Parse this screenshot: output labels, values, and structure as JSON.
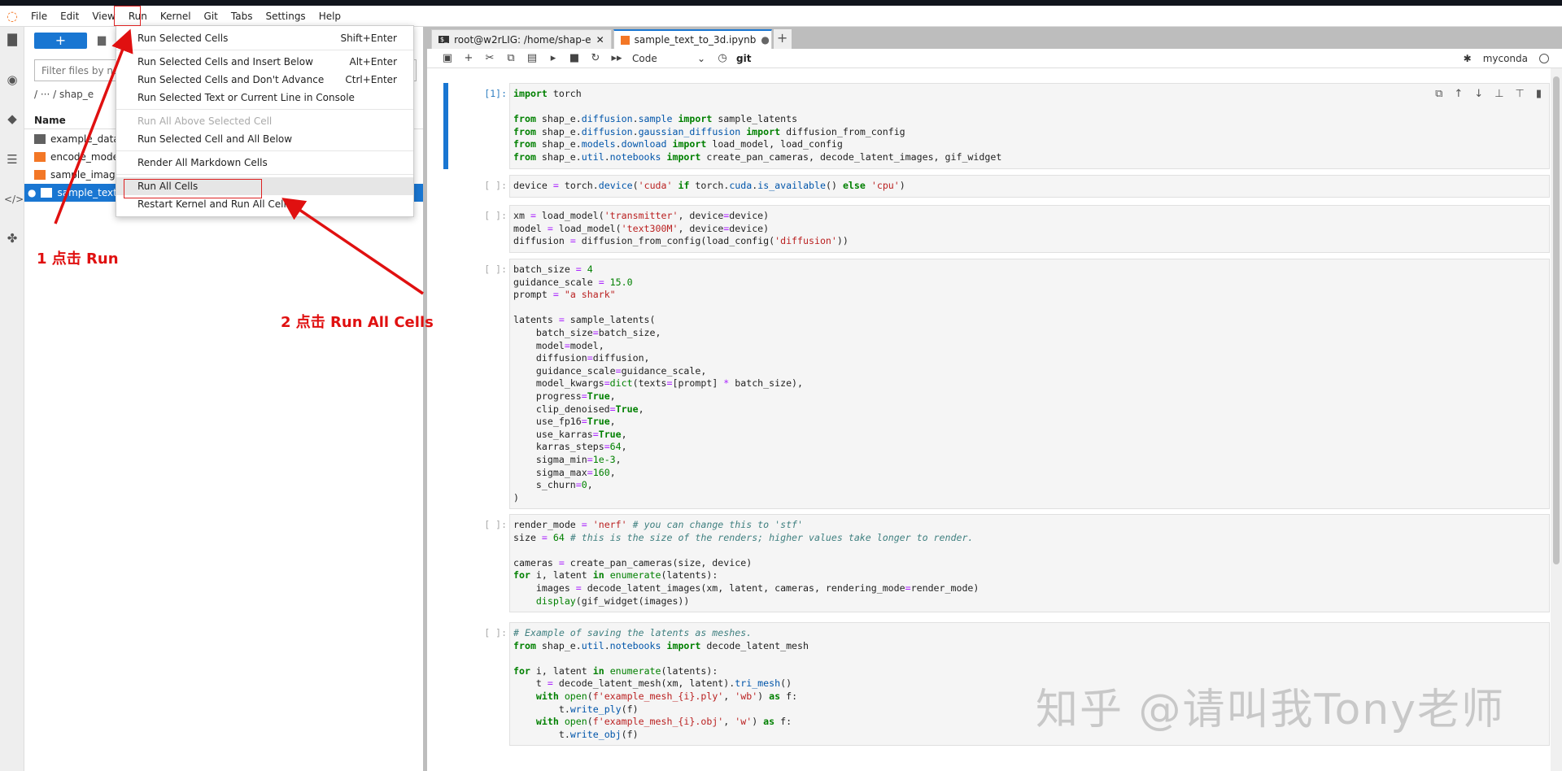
{
  "menubar": {
    "items": [
      "File",
      "Edit",
      "View",
      "Run",
      "Kernel",
      "Git",
      "Tabs",
      "Settings",
      "Help"
    ]
  },
  "sidebar_icons": [
    "folder-icon",
    "running-icon",
    "git-icon",
    "toc-icon",
    "property-inspector-icon",
    "extension-icon"
  ],
  "filebrowser": {
    "new_label": "+",
    "filter_placeholder": "Filter files by name",
    "breadcrumb": "/   ···   / shap_e",
    "name_header": "Name",
    "files": [
      {
        "name": "example_data",
        "type": "folder"
      },
      {
        "name": "encode_model",
        "type": "notebook"
      },
      {
        "name": "sample_image_",
        "type": "notebook"
      },
      {
        "name": "sample_text_to",
        "type": "notebook",
        "selected": true
      }
    ]
  },
  "run_menu": {
    "groups": [
      [
        {
          "label": "Run Selected Cells",
          "shortcut": "Shift+Enter"
        }
      ],
      [
        {
          "label": "Run Selected Cells and Insert Below",
          "shortcut": "Alt+Enter"
        },
        {
          "label": "Run Selected Cells and Don't Advance",
          "shortcut": "Ctrl+Enter"
        },
        {
          "label": "Run Selected Text or Current Line in Console",
          "shortcut": ""
        }
      ],
      [
        {
          "label": "Run All Above Selected Cell",
          "shortcut": "",
          "disabled": true
        },
        {
          "label": "Run Selected Cell and All Below",
          "shortcut": ""
        }
      ],
      [
        {
          "label": "Render All Markdown Cells",
          "shortcut": ""
        }
      ],
      [
        {
          "label": "Run All Cells",
          "shortcut": "",
          "highlighted": true
        },
        {
          "label": "Restart Kernel and Run All Cells...",
          "shortcut": ""
        }
      ]
    ]
  },
  "tabs": [
    {
      "label": "root@w2rLIG: /home/shap-e",
      "type": "terminal",
      "close": "✕"
    },
    {
      "label": "sample_text_to_3d.ipynb",
      "type": "notebook",
      "active": true,
      "close": "●"
    }
  ],
  "toolbar": {
    "cell_type": "Code",
    "git": "git",
    "kernel_name": "myconda"
  },
  "cells": [
    {
      "prompt": "[1]:",
      "active": true,
      "lines": [
        "import torch",
        "",
        "from shap_e.diffusion.sample import sample_latents",
        "from shap_e.diffusion.gaussian_diffusion import diffusion_from_config",
        "from shap_e.models.download import load_model, load_config",
        "from shap_e.util.notebooks import create_pan_cameras, decode_latent_images, gif_widget"
      ]
    },
    {
      "prompt": "[ ]:",
      "lines": [
        "device = torch.device('cuda' if torch.cuda.is_available() else 'cpu')"
      ]
    },
    {
      "prompt": "[ ]:",
      "lines": [
        "xm = load_model('transmitter', device=device)",
        "model = load_model('text300M', device=device)",
        "diffusion = diffusion_from_config(load_config('diffusion'))"
      ]
    },
    {
      "prompt": "[ ]:",
      "lines": [
        "batch_size = 4",
        "guidance_scale = 15.0",
        "prompt = \"a shark\"",
        "",
        "latents = sample_latents(",
        "    batch_size=batch_size,",
        "    model=model,",
        "    diffusion=diffusion,",
        "    guidance_scale=guidance_scale,",
        "    model_kwargs=dict(texts=[prompt] * batch_size),",
        "    progress=True,",
        "    clip_denoised=True,",
        "    use_fp16=True,",
        "    use_karras=True,",
        "    karras_steps=64,",
        "    sigma_min=1e-3,",
        "    sigma_max=160,",
        "    s_churn=0,",
        ")"
      ]
    },
    {
      "prompt": "[ ]:",
      "lines": [
        "render_mode = 'nerf' # you can change this to 'stf'",
        "size = 64 # this is the size of the renders; higher values take longer to render.",
        "",
        "cameras = create_pan_cameras(size, device)",
        "for i, latent in enumerate(latents):",
        "    images = decode_latent_images(xm, latent, cameras, rendering_mode=render_mode)",
        "    display(gif_widget(images))"
      ]
    },
    {
      "prompt": "[ ]:",
      "lines": [
        "# Example of saving the latents as meshes.",
        "from shap_e.util.notebooks import decode_latent_mesh",
        "",
        "for i, latent in enumerate(latents):",
        "    t = decode_latent_mesh(xm, latent).tri_mesh()",
        "    with open(f'example_mesh_{i}.ply', 'wb') as f:",
        "        t.write_ply(f)",
        "    with open(f'example_mesh_{i}.obj', 'w') as f:",
        "        t.write_obj(f)"
      ]
    }
  ],
  "annotations": {
    "step1": "1 点击 Run",
    "step2": "2 点击 Run All Cells",
    "color": "#e01010"
  },
  "watermark": "知乎 @请叫我Tony老师",
  "colors": {
    "accent": "#1976d2",
    "annotation": "#e01010"
  }
}
